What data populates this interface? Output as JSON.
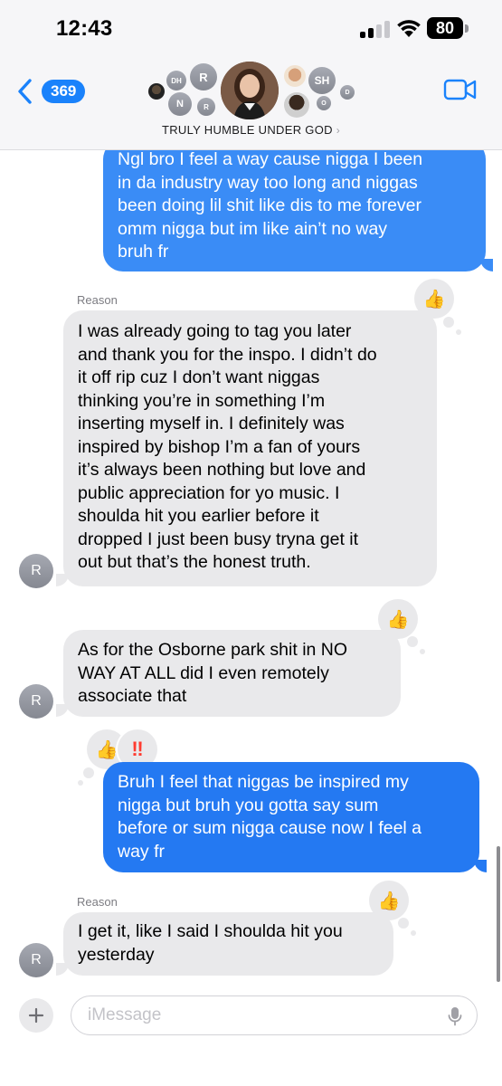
{
  "status_bar": {
    "time": "12:43",
    "battery": "80"
  },
  "header": {
    "back_count": "369",
    "group_name": "TRULY HUMBLE UNDER GOD",
    "chevron": "›",
    "avatars": [
      "DH",
      "R",
      "N",
      "R",
      "SH",
      "O",
      "D"
    ]
  },
  "messages": [
    {
      "direction": "outgoing",
      "lines": [
        "Ngl bro I feel a way cause nigga I been",
        "in da industry way too long and niggas",
        "been doing lil shit like dis to me forever",
        "omm nigga but im like ain’t no way",
        "bruh fr"
      ]
    },
    {
      "direction": "incoming",
      "sender": "Reason",
      "avatar": "R",
      "tapback": "thumbs-up",
      "lines": [
        "I was already going to tag you later",
        "and thank you for the inspo. I didn’t do",
        "it off rip cuz I don’t want niggas",
        "thinking you’re in something I’m",
        "inserting myself in. I definitely was",
        "inspired by bishop I’m a fan of yours",
        "it’s always been nothing but love and",
        "public appreciation for yo music. I",
        "shoulda hit you earlier before it",
        "dropped I just been busy tryna get it",
        "out but that’s the honest truth."
      ]
    },
    {
      "direction": "incoming",
      "avatar": "R",
      "tapback": "thumbs-up",
      "lines": [
        "As for the Osborne park shit in NO",
        "WAY AT ALL did I even remotely",
        "associate that"
      ]
    },
    {
      "direction": "outgoing",
      "tapbacks": [
        "thumbs-up",
        "double-exclamation"
      ],
      "lines": [
        "Bruh I feel that niggas be inspired my",
        "nigga but bruh you gotta say sum",
        "before or sum nigga cause now I feel a",
        "way fr"
      ]
    },
    {
      "direction": "incoming",
      "sender": "Reason",
      "avatar": "R",
      "tapback": "thumbs-up",
      "lines": [
        "I get it, like I said I shoulda hit you",
        "yesterday"
      ]
    }
  ],
  "composer": {
    "placeholder": "iMessage"
  },
  "colors": {
    "outgoing": "#3a8cf6",
    "incoming": "#e9e9eb",
    "accent": "#1a82fb",
    "reaction": "#ff3b30"
  }
}
